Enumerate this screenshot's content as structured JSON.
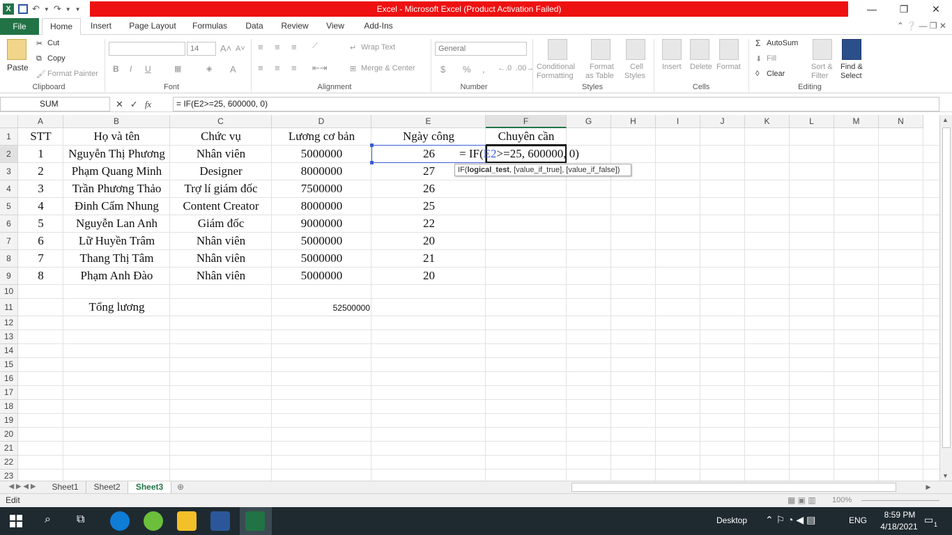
{
  "window": {
    "title": "Excel - Microsoft Excel (Product Activation Failed)",
    "minimize": "—",
    "restore": "❐",
    "close": "✕"
  },
  "tabs": [
    "File",
    "Home",
    "Insert",
    "Page Layout",
    "Formulas",
    "Data",
    "Review",
    "View",
    "Add-Ins"
  ],
  "ribbon": {
    "clipboard": {
      "paste": "Paste",
      "cut": "Cut",
      "copy": "Copy",
      "format_painter": "Format Painter",
      "label": "Clipboard"
    },
    "font": {
      "name": "",
      "size": "14",
      "bold": "B",
      "italic": "I",
      "underline": "U",
      "label": "Font"
    },
    "alignment": {
      "wrap_text": "Wrap Text",
      "merge_center": "Merge & Center",
      "label": "Alignment"
    },
    "number": {
      "format": "General",
      "currency": "$",
      "percent": "%",
      "comma": ",",
      "label": "Number"
    },
    "styles": {
      "conditional": "Conditional",
      "conditional2": "Formatting",
      "format_as": "Format",
      "format_as2": "as Table",
      "cell_styles": "Cell",
      "cell_styles2": "Styles",
      "label": "Styles"
    },
    "cells": {
      "insert": "Insert",
      "delete": "Delete",
      "format": "Format",
      "label": "Cells"
    },
    "editing": {
      "autosum": "AutoSum",
      "fill": "Fill",
      "clear": "Clear",
      "sort": "Sort &",
      "sort2": "Filter",
      "find": "Find &",
      "find2": "Select",
      "label": "Editing"
    }
  },
  "formula_bar": {
    "name_box": "SUM",
    "fx": "fx",
    "formula": "= IF(E2>=25, 600000, 0)"
  },
  "columns": [
    "A",
    "B",
    "C",
    "D",
    "E",
    "F",
    "G",
    "H",
    "I",
    "J",
    "K",
    "L",
    "M",
    "N"
  ],
  "rows": [
    "1",
    "2",
    "3",
    "4",
    "5",
    "6",
    "7",
    "8",
    "9",
    "10",
    "11",
    "12",
    "13",
    "14",
    "15",
    "16",
    "17",
    "18",
    "19",
    "20",
    "21",
    "22",
    "23"
  ],
  "headers": {
    "stt": "STT",
    "name": "Họ và tên",
    "role": "Chức vụ",
    "salary": "Lương cơ bản",
    "days": "Ngày công",
    "bonus": "Chuyên cần"
  },
  "data_rows": [
    {
      "stt": "1",
      "name": "Nguyễn Thị Phương",
      "role": "Nhân viên",
      "salary": "5000000",
      "days": "26"
    },
    {
      "stt": "2",
      "name": "Phạm Quang Minh",
      "role": "Designer",
      "salary": "8000000",
      "days": "27"
    },
    {
      "stt": "3",
      "name": "Trần Phương Thảo",
      "role": "Trợ lí giám đốc",
      "salary": "7500000",
      "days": "26"
    },
    {
      "stt": "4",
      "name": "Đinh Cẩm Nhung",
      "role": "Content Creator",
      "salary": "8000000",
      "days": "25"
    },
    {
      "stt": "5",
      "name": "Nguyễn Lan Anh",
      "role": "Giám đốc",
      "salary": "9000000",
      "days": "22"
    },
    {
      "stt": "6",
      "name": "Lữ Huyền Trâm",
      "role": "Nhân viên",
      "salary": "5000000",
      "days": "20"
    },
    {
      "stt": "7",
      "name": "Thang Thị Tâm",
      "role": "Nhân viên",
      "salary": "5000000",
      "days": "21"
    },
    {
      "stt": "8",
      "name": "Phạm Anh Đào",
      "role": "Nhân viên",
      "salary": "5000000",
      "days": "20"
    }
  ],
  "total": {
    "label": "Tổng lương",
    "value": "52500000"
  },
  "edit_cell": {
    "prefix": "= IF(",
    "ref": "E2",
    "suffix": ">=25, 600000, 0)"
  },
  "tooltip": {
    "fn": "IF(",
    "arg1": "logical_test",
    "rest": ", [value_if_true], [value_if_false])"
  },
  "sheets": [
    "Sheet1",
    "Sheet2",
    "Sheet3"
  ],
  "active_sheet": "Sheet3",
  "status": {
    "mode": "Edit",
    "zoom": "100%"
  },
  "taskbar": {
    "desktop": "Desktop",
    "lang": "ENG",
    "time": "8:59 PM",
    "date": "4/18/2021",
    "notif": "1"
  },
  "colors": {
    "excel_green": "#217346",
    "title_red": "#ee1111",
    "taskbar": "#1f2a30",
    "ref_blue": "#3b5bd6"
  }
}
